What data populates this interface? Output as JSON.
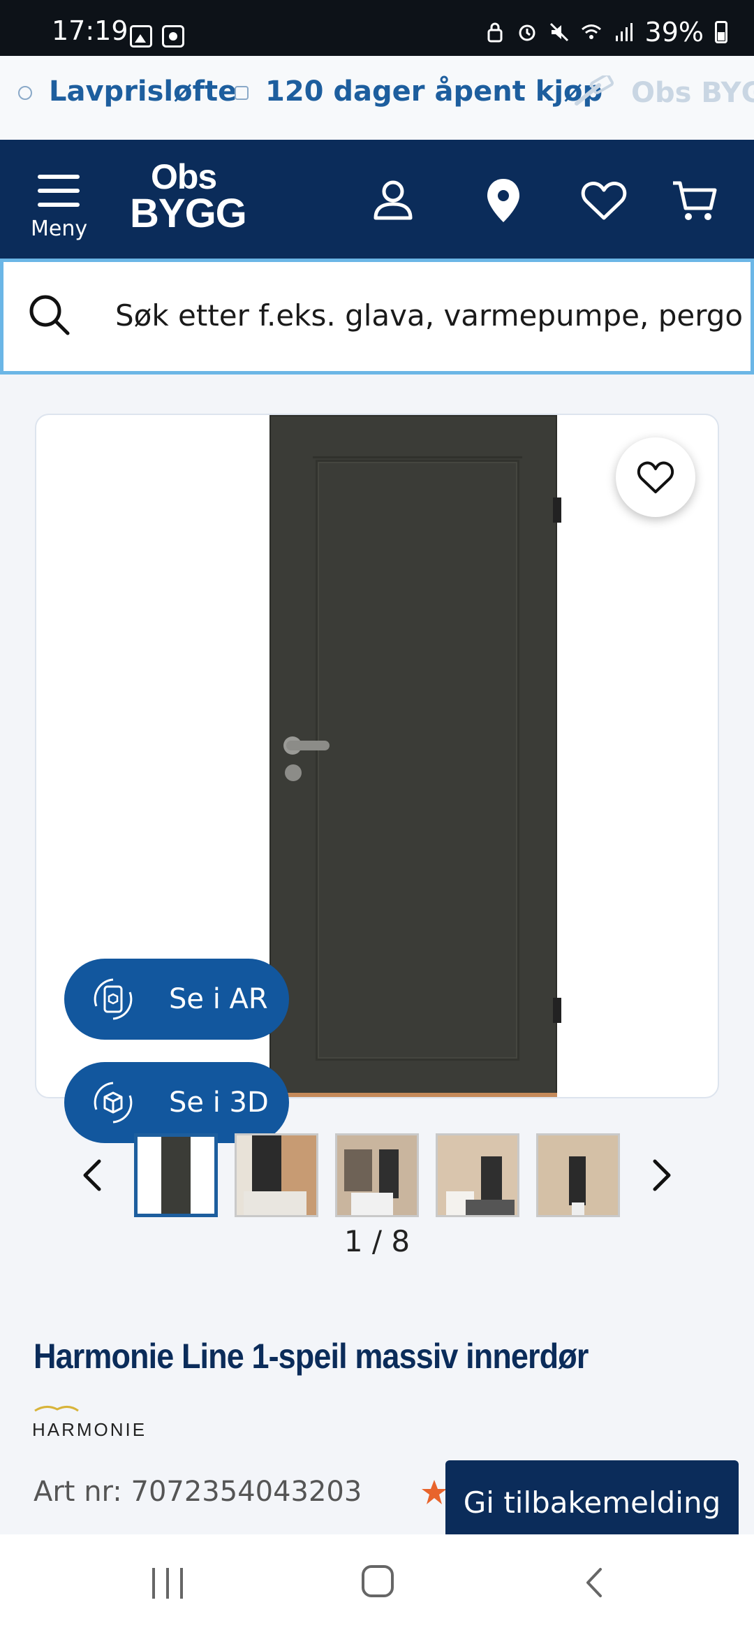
{
  "status_bar": {
    "time": "17:19",
    "battery": "39%"
  },
  "promo": {
    "items": [
      "Lavprisløfte",
      "120 dager åpent kjøp",
      "Obs BYGG"
    ]
  },
  "header": {
    "menu_label": "Meny",
    "logo_line1": "Obs",
    "logo_line2": "BYGG"
  },
  "search": {
    "placeholder": "Søk etter f.eks. glava, varmepumpe, pergola"
  },
  "gallery": {
    "ar_label": "Se i AR",
    "view3d_label": "Se i 3D",
    "counter": "1 / 8",
    "current": 1,
    "total": 8
  },
  "product": {
    "title": "Harmonie Line 1-speil massiv innerdør",
    "brand": "HARMONIE",
    "art_nr": "Art nr: 7072354043203"
  },
  "feedback": {
    "label": "Gi tilbakemelding"
  },
  "colors": {
    "brand_navy": "#0b2c5a",
    "accent_blue": "#12579e",
    "search_border": "#6bb6e6",
    "door": "#3b3c37"
  }
}
